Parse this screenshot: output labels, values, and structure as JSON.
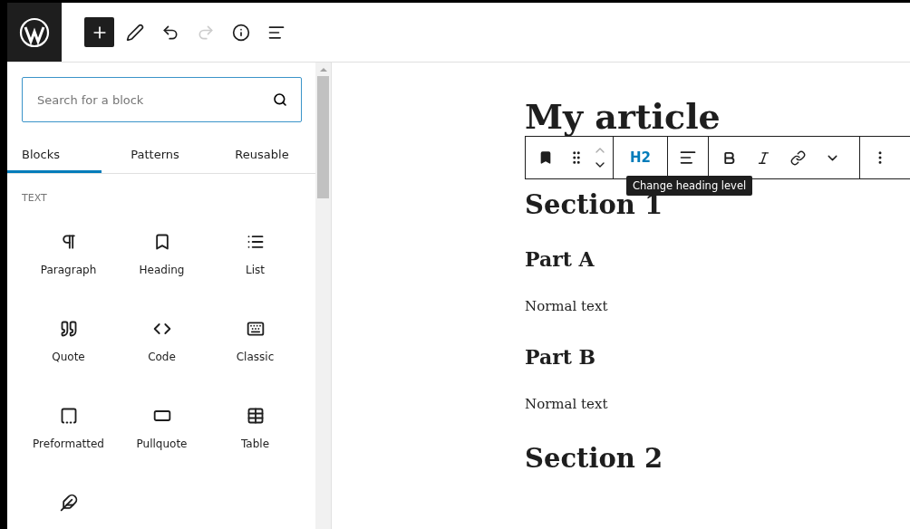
{
  "top_toolbar": {
    "inserter_open": true,
    "redo_disabled": true
  },
  "inserter": {
    "search": {
      "placeholder": "Search for a block"
    },
    "tabs": [
      {
        "label": "Blocks",
        "selected": true
      },
      {
        "label": "Patterns",
        "selected": false
      },
      {
        "label": "Reusable",
        "selected": false
      }
    ],
    "category": "TEXT",
    "blocks": [
      "Paragraph",
      "Heading",
      "List",
      "Quote",
      "Code",
      "Classic",
      "Preformatted",
      "Pullquote",
      "Table"
    ]
  },
  "editor": {
    "content": [
      {
        "kind": "title",
        "text": "My article"
      },
      {
        "kind": "h2",
        "text": "Section 1"
      },
      {
        "kind": "h3",
        "text": "Part A"
      },
      {
        "kind": "p",
        "text": "Normal text"
      },
      {
        "kind": "h3",
        "text": "Part B"
      },
      {
        "kind": "p",
        "text": "Normal text"
      },
      {
        "kind": "h2",
        "text": "Section 2"
      }
    ],
    "block_toolbar": {
      "heading_level": "H2",
      "tooltip": "Change heading level"
    }
  }
}
